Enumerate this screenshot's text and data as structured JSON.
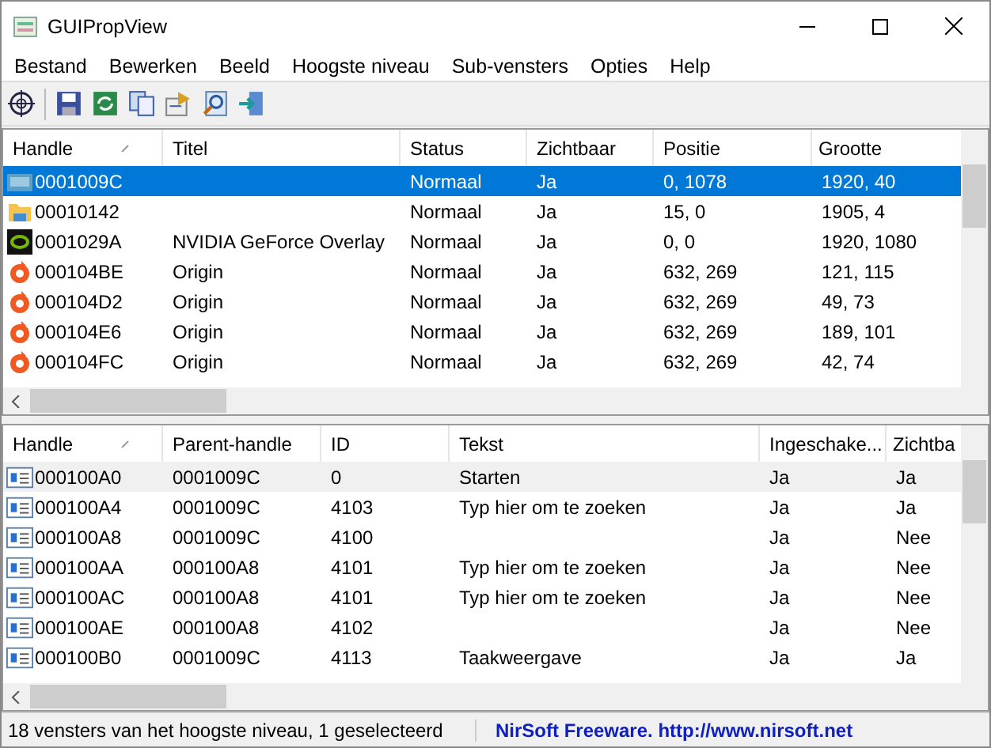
{
  "window": {
    "title": "GUIPropView"
  },
  "menu": [
    "Bestand",
    "Bewerken",
    "Beeld",
    "Hoogste niveau",
    "Sub-vensters",
    "Opties",
    "Help"
  ],
  "top_list": {
    "columns": [
      "Handle",
      "Titel",
      "Status",
      "Zichtbaar",
      "Positie",
      "Grootte"
    ],
    "rows": [
      {
        "kind": "taskbar",
        "selected": true,
        "cells": [
          "0001009C",
          "",
          "Normaal",
          "Ja",
          "0, 1078",
          "1920, 40"
        ]
      },
      {
        "kind": "folder",
        "selected": false,
        "cells": [
          "00010142",
          "",
          "Normaal",
          "Ja",
          "15, 0",
          "1905, 4"
        ]
      },
      {
        "kind": "nvidia",
        "selected": false,
        "cells": [
          "0001029A",
          "NVIDIA GeForce Overlay",
          "Normaal",
          "Ja",
          "0, 0",
          "1920, 1080"
        ]
      },
      {
        "kind": "origin",
        "selected": false,
        "cells": [
          "000104BE",
          "Origin",
          "Normaal",
          "Ja",
          "632, 269",
          "121, 115"
        ]
      },
      {
        "kind": "origin",
        "selected": false,
        "cells": [
          "000104D2",
          "Origin",
          "Normaal",
          "Ja",
          "632, 269",
          "49, 73"
        ]
      },
      {
        "kind": "origin",
        "selected": false,
        "cells": [
          "000104E6",
          "Origin",
          "Normaal",
          "Ja",
          "632, 269",
          "189, 101"
        ]
      },
      {
        "kind": "origin",
        "selected": false,
        "cells": [
          "000104FC",
          "Origin",
          "Normaal",
          "Ja",
          "632, 269",
          "42, 74"
        ]
      }
    ]
  },
  "bottom_list": {
    "columns": [
      "Handle",
      "Parent-handle",
      "ID",
      "Tekst",
      "Ingeschake...",
      "Zichtba"
    ],
    "rows": [
      {
        "kind": "window",
        "selected": true,
        "cells": [
          "000100A0",
          "0001009C",
          "0",
          "Starten",
          "Ja",
          "Ja"
        ]
      },
      {
        "kind": "window",
        "selected": false,
        "cells": [
          "000100A4",
          "0001009C",
          "4103",
          "Typ hier om te zoeken",
          "Ja",
          "Ja"
        ]
      },
      {
        "kind": "window",
        "selected": false,
        "cells": [
          "000100A8",
          "0001009C",
          "4100",
          "",
          "Ja",
          "Nee"
        ]
      },
      {
        "kind": "window",
        "selected": false,
        "cells": [
          "000100AA",
          "000100A8",
          "4101",
          "Typ hier om te zoeken",
          "Ja",
          "Nee"
        ]
      },
      {
        "kind": "window",
        "selected": false,
        "cells": [
          "000100AC",
          "000100A8",
          "4101",
          "Typ hier om te zoeken",
          "Ja",
          "Nee"
        ]
      },
      {
        "kind": "window",
        "selected": false,
        "cells": [
          "000100AE",
          "000100A8",
          "4102",
          "",
          "Ja",
          "Nee"
        ]
      },
      {
        "kind": "window",
        "selected": false,
        "cells": [
          "000100B0",
          "0001009C",
          "4113",
          "Taakweergave",
          "Ja",
          "Ja"
        ]
      }
    ]
  },
  "status_bar": {
    "text": "18 vensters van het hoogste niveau, 1 geselecteerd",
    "link": "NirSoft Freeware.  http://www.nirsoft.net"
  }
}
